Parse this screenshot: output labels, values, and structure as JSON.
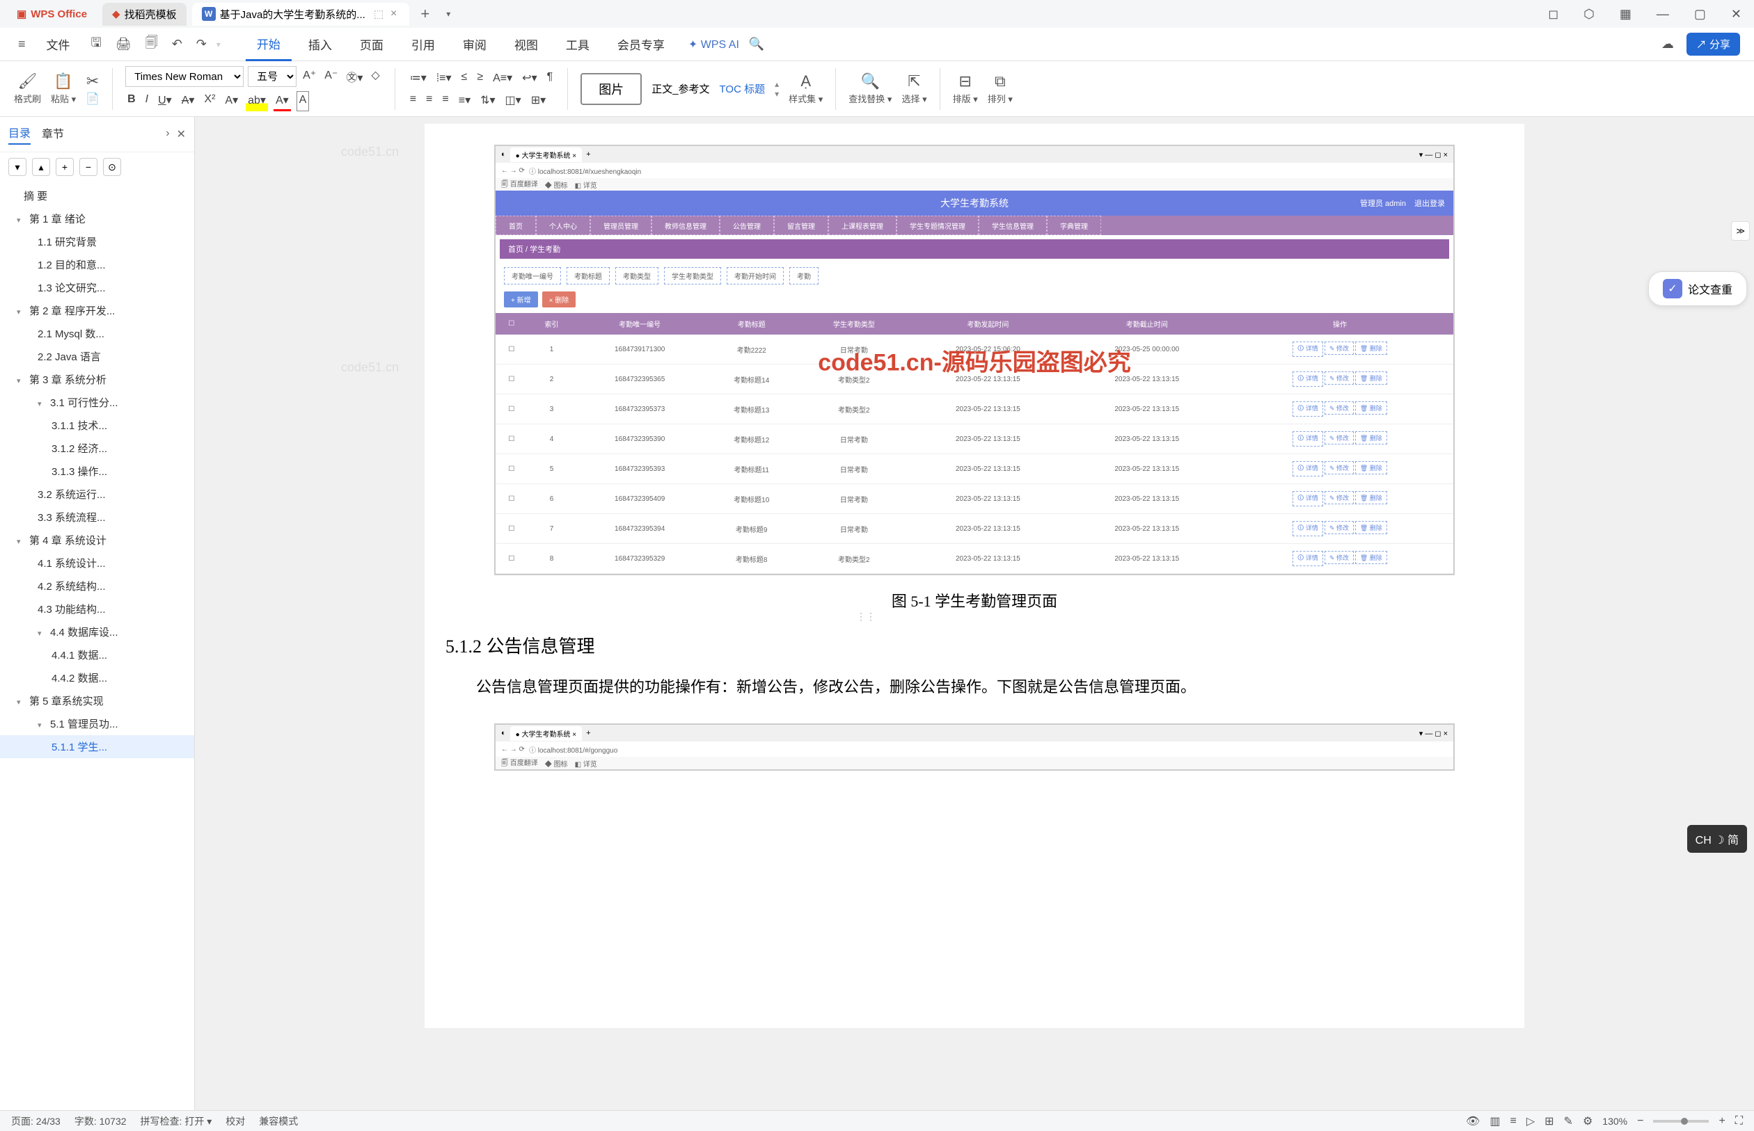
{
  "tabs": {
    "wps_office": "WPS Office",
    "template": "找稻壳模板",
    "active_doc": "基于Java的大学生考勤系统的..."
  },
  "menu": {
    "file": "文件",
    "items": [
      "开始",
      "插入",
      "页面",
      "引用",
      "审阅",
      "视图",
      "工具",
      "会员专享"
    ],
    "wps_ai": "WPS AI",
    "share": "分享"
  },
  "ribbon": {
    "format_brush": "格式刷",
    "paste": "粘贴",
    "font_name": "Times New Roman",
    "font_size": "五号",
    "image": "图片",
    "body_ref": "正文_参考文",
    "toc_title": "TOC 标题",
    "style_set": "样式集",
    "find_replace": "查找替换",
    "select": "选择",
    "layout": "排版",
    "arrange": "排列"
  },
  "sidebar": {
    "tabs": [
      "目录",
      "章节"
    ],
    "items": [
      {
        "level": 0,
        "text": "摘   要"
      },
      {
        "level": 1,
        "text": "第 1 章  绪论",
        "chev": true
      },
      {
        "level": 2,
        "text": "1.1  研究背景"
      },
      {
        "level": 2,
        "text": "1.2 目的和意..."
      },
      {
        "level": 2,
        "text": "1.3  论文研究..."
      },
      {
        "level": 1,
        "text": "第 2 章  程序开发...",
        "chev": true
      },
      {
        "level": 2,
        "text": "2.1  Mysql 数..."
      },
      {
        "level": 2,
        "text": "2.2 Java 语言"
      },
      {
        "level": 1,
        "text": "第 3 章  系统分析",
        "chev": true
      },
      {
        "level": 2,
        "text": "3.1  可行性分...",
        "chev": true
      },
      {
        "level": 3,
        "text": "3.1.1  技术..."
      },
      {
        "level": 3,
        "text": "3.1.2  经济..."
      },
      {
        "level": 3,
        "text": "3.1.3  操作..."
      },
      {
        "level": 2,
        "text": "3.2  系统运行..."
      },
      {
        "level": 2,
        "text": "3.3  系统流程..."
      },
      {
        "level": 1,
        "text": "第 4 章  系统设计",
        "chev": true
      },
      {
        "level": 2,
        "text": "4.1  系统设计..."
      },
      {
        "level": 2,
        "text": "4.2  系统结构..."
      },
      {
        "level": 2,
        "text": "4.3 功能结构..."
      },
      {
        "level": 2,
        "text": "4.4 数据库设...",
        "chev": true
      },
      {
        "level": 3,
        "text": "4.4.1  数据..."
      },
      {
        "level": 3,
        "text": "4.4.2  数据..."
      },
      {
        "level": 1,
        "text": "第 5 章系统实现",
        "chev": true
      },
      {
        "level": 2,
        "text": "5.1  管理员功...",
        "chev": true
      },
      {
        "level": 3,
        "text": "5.1.1  学生...",
        "active": true
      }
    ]
  },
  "document": {
    "caption1": "图 5-1  学生考勤管理页面",
    "heading": "5.1.2  公告信息管理",
    "para1": "公告信息管理页面提供的功能操作有：新增公告，修改公告，删除公告操作。下图就是公告信息管理页面。",
    "watermark": "code51.cn",
    "embed_watermark": "code51.cn-源码乐园盗图必究"
  },
  "embed_app": {
    "tab_title": "大学生考勤系统",
    "url": "localhost:8081/#/xueshengkaoqin",
    "url2": "localhost:8081/#/gongguo",
    "bookmark1": "百度翻译",
    "bookmark2": "图标",
    "bookmark3": "详览",
    "header_title": "大学生考勤系统",
    "header_admin": "管理员 admin",
    "header_logout": "退出登录",
    "nav_items": [
      "首页",
      "个人中心",
      "管理员管理",
      "教师信息管理",
      "公告管理",
      "留言管理",
      "上课程表管理",
      "学生专题情况管理",
      "学生信息管理",
      "字典管理"
    ],
    "breadcrumb": "首页 / 学生考勤",
    "filters": [
      "考勤唯一编号",
      "考勤标题",
      "考勤类型",
      "学生考勤类型",
      "考勤开始时间",
      "考勤"
    ],
    "action_add": "+ 新增",
    "action_del": "× 删除",
    "columns": [
      "",
      "索引",
      "考勤唯一编号",
      "考勤标题",
      "学生考勤类型",
      "考勤发起时间",
      "考勤截止时间",
      "操作"
    ],
    "rows": [
      {
        "idx": "1",
        "id": "1684739171300",
        "title": "考勤2222",
        "type": "日常考勤",
        "start": "2023-05-22 15:06:20",
        "end": "2023-05-25 00:00:00"
      },
      {
        "idx": "2",
        "id": "1684732395365",
        "title": "考勤标题14",
        "type": "考勤类型2",
        "start": "2023-05-22 13:13:15",
        "end": "2023-05-22 13:13:15"
      },
      {
        "idx": "3",
        "id": "1684732395373",
        "title": "考勤标题13",
        "type": "考勤类型2",
        "start": "2023-05-22 13:13:15",
        "end": "2023-05-22 13:13:15"
      },
      {
        "idx": "4",
        "id": "1684732395390",
        "title": "考勤标题12",
        "type": "日常考勤",
        "start": "2023-05-22 13:13:15",
        "end": "2023-05-22 13:13:15"
      },
      {
        "idx": "5",
        "id": "1684732395393",
        "title": "考勤标题11",
        "type": "日常考勤",
        "start": "2023-05-22 13:13:15",
        "end": "2023-05-22 13:13:15"
      },
      {
        "idx": "6",
        "id": "1684732395409",
        "title": "考勤标题10",
        "type": "日常考勤",
        "start": "2023-05-22 13:13:15",
        "end": "2023-05-22 13:13:15"
      },
      {
        "idx": "7",
        "id": "1684732395394",
        "title": "考勤标题9",
        "type": "日常考勤",
        "start": "2023-05-22 13:13:15",
        "end": "2023-05-22 13:13:15"
      },
      {
        "idx": "8",
        "id": "1684732395329",
        "title": "考勤标题8",
        "type": "考勤类型2",
        "start": "2023-05-22 13:13:15",
        "end": "2023-05-22 13:13:15"
      }
    ],
    "row_btns": [
      "🛈 详情",
      "✎ 修改",
      "🗑 删除"
    ]
  },
  "right_panel": {
    "paper_check": "论文查重"
  },
  "ime": "CH ☽ 简",
  "status": {
    "page": "页面: 24/33",
    "words": "字数: 10732",
    "spell": "拼写检查: 打开",
    "proofread": "校对",
    "compat": "兼容模式",
    "zoom": "130%"
  }
}
